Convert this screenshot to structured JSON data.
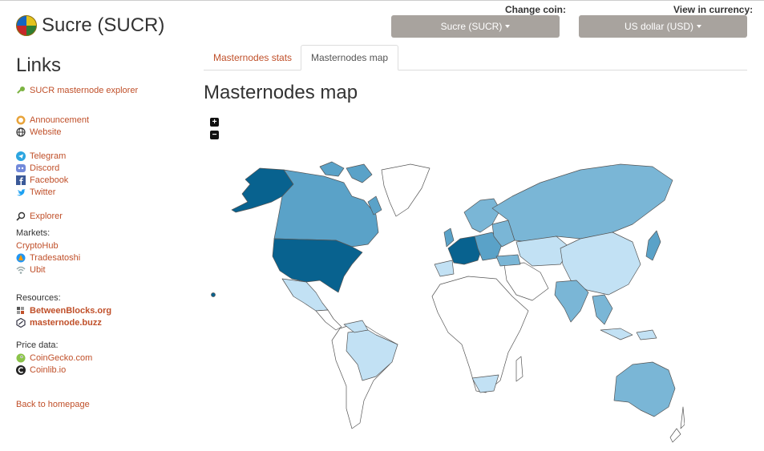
{
  "coin": {
    "name": "Sucre (SUCR)",
    "logo_icon": "sucre-coin-logo"
  },
  "selectors": {
    "coin": {
      "label": "Change coin:",
      "value": "Sucre (SUCR)"
    },
    "currency": {
      "label": "View in currency:",
      "value": "US dollar (USD)"
    }
  },
  "sidebar": {
    "title": "Links",
    "explorer_link": "SUCR masternode explorer",
    "general": [
      "Announcement",
      "Website"
    ],
    "social": [
      "Telegram",
      "Discord",
      "Facebook",
      "Twitter"
    ],
    "explorer": "Explorer",
    "markets_label": "Markets:",
    "markets": [
      "CryptoHub",
      "Tradesatoshi",
      "Ubit"
    ],
    "resources_label": "Resources:",
    "resources": [
      "BetweenBlocks.org",
      "masternode.buzz"
    ],
    "price_label": "Price data:",
    "price": [
      "CoinGecko.com",
      "Coinlib.io"
    ],
    "back": "Back to homepage"
  },
  "tabs": [
    {
      "label": "Masternodes stats",
      "active": false
    },
    {
      "label": "Masternodes map",
      "active": true
    }
  ],
  "main": {
    "title": "Masternodes map"
  },
  "map": {
    "zoom_in": "+",
    "zoom_out": "−",
    "colors": {
      "max": "#08628f",
      "high": "#5aa2c8",
      "mid": "#7ab6d6",
      "low": "#c2e1f4",
      "none": "#ffffff",
      "border": "#555555"
    }
  }
}
